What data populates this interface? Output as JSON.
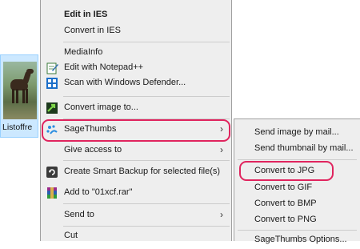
{
  "file": {
    "name": "Listoffre"
  },
  "menu": {
    "items": [
      {
        "label": "Edit in IES",
        "bold": true
      },
      {
        "label": "Convert in IES"
      },
      {
        "label": "MediaInfo"
      },
      {
        "label": "Edit with Notepad++",
        "icon": "notepad-icon"
      },
      {
        "label": "Scan with Windows Defender...",
        "icon": "defender-shield-icon"
      },
      {
        "label": "Convert image to...",
        "icon": "convert-arrow-icon"
      },
      {
        "label": "SageThumbs",
        "icon": "sagethumbs-icon",
        "submenu": true
      },
      {
        "label": "Give access to",
        "submenu": true
      },
      {
        "label": "Create Smart Backup for selected file(s)",
        "icon": "backup-icon"
      },
      {
        "label": "Add to \"01xcf.rar\"",
        "icon": "winrar-icon"
      },
      {
        "label": "Send to",
        "submenu": true
      },
      {
        "label": "Cut"
      }
    ]
  },
  "submenu": {
    "items": [
      {
        "label": "Send image by mail..."
      },
      {
        "label": "Send thumbnail by mail..."
      },
      {
        "label": "Convert to JPG"
      },
      {
        "label": "Convert to GIF"
      },
      {
        "label": "Convert to BMP"
      },
      {
        "label": "Convert to PNG"
      },
      {
        "label": "SageThumbs Options..."
      }
    ]
  },
  "colors": {
    "highlight": "#e0245e",
    "menu_bg": "#eeeeee",
    "selection": "#cce8ff"
  },
  "icons": {
    "arrow": "›"
  }
}
